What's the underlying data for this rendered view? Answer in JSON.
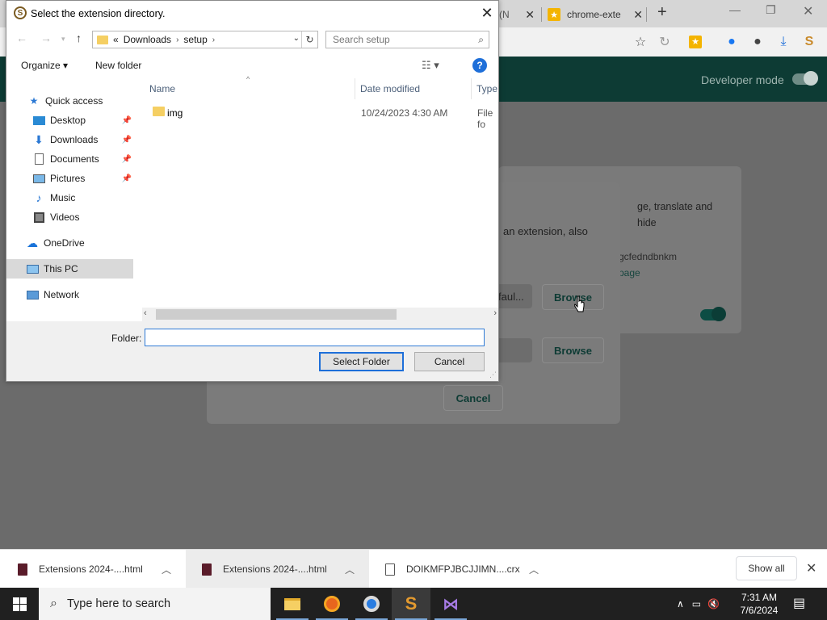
{
  "browser": {
    "tabs": [
      {
        "title": "(N",
        "close": "✕"
      },
      {
        "title": "chrome-exte",
        "close": "✕"
      }
    ],
    "new_tab": "+",
    "window_buttons": [
      "—",
      "❐",
      "✕"
    ]
  },
  "extensions_page": {
    "developer_mode_label": "Developer mode",
    "card_description": "ge, translate and hide",
    "card_id": "gcfedndbnkm",
    "card_link": "page"
  },
  "pack_dialog": {
    "description": "an extension, also",
    "field1_value": "faul...",
    "browse_label": "Browse",
    "cancel_label": "Cancel"
  },
  "file_dialog": {
    "title": "Select the extension directory.",
    "close": "✕",
    "address": {
      "prefix": "«",
      "segments": [
        "Downloads",
        "setup"
      ]
    },
    "search_placeholder": "Search setup",
    "organize_label": "Organize ▾",
    "new_folder_label": "New folder",
    "help": "?",
    "nav_items": [
      {
        "label": "Quick access",
        "icon": "star-icon",
        "pinned": false
      },
      {
        "label": "Desktop",
        "icon": "desktop-icon",
        "pinned": true
      },
      {
        "label": "Downloads",
        "icon": "download-icon",
        "pinned": true
      },
      {
        "label": "Documents",
        "icon": "documents-icon",
        "pinned": true
      },
      {
        "label": "Pictures",
        "icon": "pictures-icon",
        "pinned": true
      },
      {
        "label": "Music",
        "icon": "music-icon",
        "pinned": false
      },
      {
        "label": "Videos",
        "icon": "videos-icon",
        "pinned": false
      },
      {
        "label": "OneDrive",
        "icon": "cloud-icon",
        "pinned": false
      },
      {
        "label": "This PC",
        "icon": "computer-icon",
        "pinned": false,
        "selected": true
      },
      {
        "label": "Network",
        "icon": "network-icon",
        "pinned": false
      }
    ],
    "columns": {
      "name": "Name",
      "date": "Date modified",
      "type": "Type"
    },
    "files": [
      {
        "name": "img",
        "date": "10/24/2023 4:30 AM",
        "type": "File fo"
      }
    ],
    "folder_label": "Folder:",
    "folder_value": "",
    "select_button": "Select Folder",
    "cancel_button": "Cancel"
  },
  "download_shelf": {
    "items": [
      {
        "name": "Extensions 2024-....html",
        "kind": "html"
      },
      {
        "name": "Extensions 2024-....html",
        "kind": "html"
      },
      {
        "name": "DOIKMFPJBCJJIMN....crx",
        "kind": "crx"
      }
    ],
    "show_all": "Show all",
    "close": "✕"
  },
  "taskbar": {
    "search_placeholder": "Type here to search",
    "time": "7:31 AM",
    "date": "7/6/2024"
  },
  "colors": {
    "accent_blue": "#1e6fd9",
    "header_green": "#0d3b34",
    "folder_yellow": "#f5cf63",
    "taskbar": "#202020"
  }
}
